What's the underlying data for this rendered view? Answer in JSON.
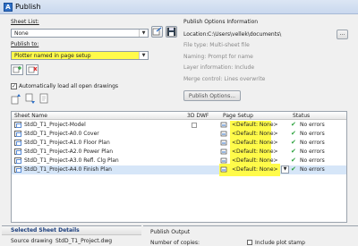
{
  "window": {
    "title": "Publish",
    "app_icon": "autocad-publish-icon"
  },
  "sheet_list": {
    "label": "Sheet List:",
    "value": "None"
  },
  "publish_to": {
    "label": "Publish to:",
    "value": "Plotter named in page setup"
  },
  "auto_load": {
    "label": "Automatically load all open drawings",
    "checked": true
  },
  "publish_options": {
    "heading": "Publish Options Information",
    "location_label": "Location:",
    "location_value": "C:\\Users\\vellek\\documents\\",
    "browse_label": "...",
    "lines": [
      "File type: Multi-sheet file",
      "Naming: Prompt for name",
      "Layer information: Include",
      "Merge control: Lines overwrite"
    ],
    "button_label": "Publish Options..."
  },
  "table": {
    "columns": [
      "Sheet Name",
      "3D DWF",
      "Page Setup",
      "Status"
    ],
    "rows": [
      {
        "name": "StdD_T1_Project-Model",
        "page_setup": "<Default: None>",
        "status": "No errors"
      },
      {
        "name": "StdD_T1_Project-A0.0 Cover",
        "page_setup": "<Default: None>",
        "status": "No errors"
      },
      {
        "name": "StdD_T1_Project-A1.0 Floor Plan",
        "page_setup": "<Default: None>",
        "status": "No errors"
      },
      {
        "name": "StdD_T1_Project-A2.0 Power Plan",
        "page_setup": "<Default: None>",
        "status": "No errors"
      },
      {
        "name": "StdD_T1_Project-A3.0 Refl. Clg Plan",
        "page_setup": "<Default: None>",
        "status": "No errors"
      },
      {
        "name": "StdD_T1_Project-A4.0 Finish Plan",
        "page_setup": "<Default: None>",
        "status": "No errors"
      }
    ],
    "selected_row": 5
  },
  "details": {
    "heading": "Selected Sheet Details",
    "source_label": "Source drawing",
    "source_value": "StdD_T1_Project.dwg"
  },
  "output": {
    "heading": "Publish Output",
    "copies_label": "Number of copies:",
    "stamp_label": "Include plot stamp"
  },
  "colors": {
    "highlight": "#fffb4a",
    "ok_tick": "#2aa13b",
    "selection": "#d6e6f8"
  }
}
